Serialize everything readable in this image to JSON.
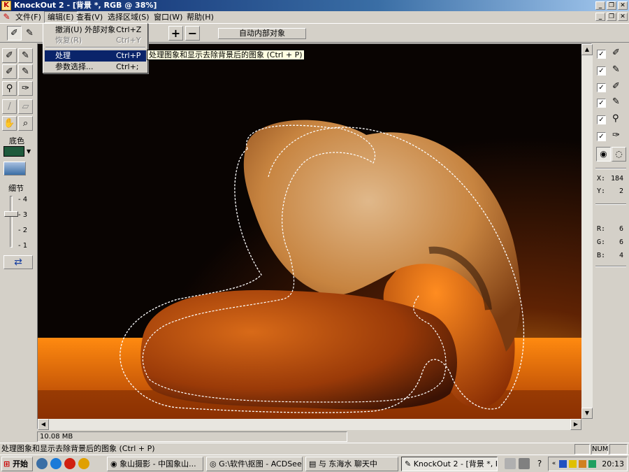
{
  "window": {
    "title": "KnockOut 2 - [背景 *, RGB @ 38%]"
  },
  "menu": {
    "items": [
      "文件(F)",
      "编辑(E)",
      "查看(V)",
      "选择区域(S)",
      "窗口(W)",
      "帮助(H)"
    ]
  },
  "edit_menu": {
    "items": [
      {
        "label": "撤消(U) 外部对象",
        "shortcut": "Ctrl+Z",
        "state": "enabled"
      },
      {
        "label": "恢复(R)",
        "shortcut": "Ctrl+Y",
        "state": "disabled"
      },
      {
        "label": "处理",
        "shortcut": "Ctrl+P",
        "state": "selected"
      },
      {
        "label": "参数选择...",
        "shortcut": "Ctrl+;",
        "state": "enabled"
      }
    ]
  },
  "tooltip": "处理图象和显示去除背景后的图象 (Ctrl + P)",
  "toolbar": {
    "plus": "+",
    "minus": "−",
    "auto_inside": "自动内部对象"
  },
  "left_panel": {
    "background_label": "底色",
    "background_color": "#1e5a3c",
    "detail_label": "细节",
    "ticks": [
      "4",
      "3",
      "2",
      "1"
    ],
    "detail_level": 3
  },
  "right_panel": {
    "x_label": "X:",
    "x_value": "184",
    "y_label": "Y:",
    "y_value": "2",
    "r_label": "R:",
    "r_value": "6",
    "g_label": "G:",
    "g_value": "6",
    "b_label": "B:",
    "b_value": "4"
  },
  "doc_size": "10.08 MB",
  "status": {
    "text": "处理图象和显示去除背景后的图象 (Ctrl + P)",
    "num": "NUM"
  },
  "taskbar": {
    "start": "开始",
    "tasks": [
      "象山摄影 - 中国象山...",
      "G:\\软件\\抠图 - ACDSee...",
      "与 东海水 聊天中",
      "KnockOut 2 - [背景 *, R..."
    ],
    "clock": "20:13"
  },
  "icons": {
    "window_min": "minimize-icon",
    "window_restore": "restore-icon",
    "window_close": "close-icon"
  }
}
